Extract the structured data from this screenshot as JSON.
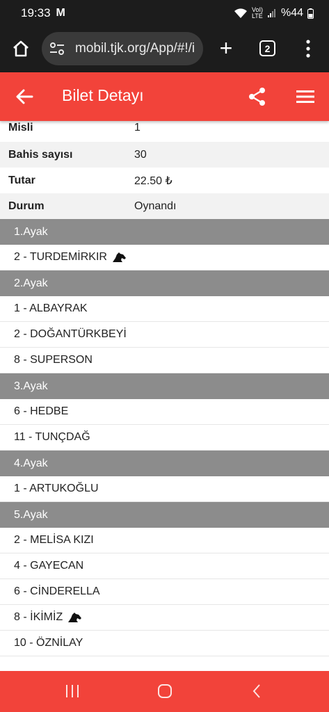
{
  "status_bar": {
    "time": "19:33",
    "m_badge": "M",
    "volte_top": "VoI)",
    "volte_bottom": "LTE",
    "battery": "%44"
  },
  "browser": {
    "url": "mobil.tjk.org/App/#!/i",
    "tab_count": "2"
  },
  "header": {
    "title": "Bilet Detayı"
  },
  "info": [
    {
      "key": "Misli",
      "value": "1"
    },
    {
      "key": "Bahis sayısı",
      "value": "30"
    },
    {
      "key": "Tutar",
      "value": "22.50 ₺"
    },
    {
      "key": "Durum",
      "value": "Oynandı"
    }
  ],
  "legs": [
    {
      "title": "1.Ayak",
      "horses": [
        {
          "label": "2 - TURDEMİRKIR",
          "icon": true
        }
      ]
    },
    {
      "title": "2.Ayak",
      "horses": [
        {
          "label": "1 - ALBAYRAK"
        },
        {
          "label": "2 - DOĞANTÜRKBEYİ"
        },
        {
          "label": "8 - SUPERSON"
        }
      ]
    },
    {
      "title": "3.Ayak",
      "horses": [
        {
          "label": "6 - HEDBE"
        },
        {
          "label": "11 - TUNÇDAĞ"
        }
      ]
    },
    {
      "title": "4.Ayak",
      "horses": [
        {
          "label": "1 - ARTUKOĞLU"
        }
      ]
    },
    {
      "title": "5.Ayak",
      "horses": [
        {
          "label": "2 - MELİSA KIZI"
        },
        {
          "label": "4 - GAYECAN"
        },
        {
          "label": "6 - CİNDERELLA"
        },
        {
          "label": "8 - İKİMİZ",
          "icon": true
        },
        {
          "label": "10 - ÖZNİLAY"
        }
      ]
    }
  ],
  "colors": {
    "accent": "#f2433a",
    "leg_header": "#8c8c8c",
    "browser_dark": "#1c1c1c"
  },
  "icons": {
    "home": "home-icon",
    "site_settings": "tune-icon",
    "new_tab": "plus-icon",
    "tabs": "tab-switcher-icon",
    "more": "more-vert-icon",
    "back": "arrow-back-icon",
    "share": "share-icon",
    "menu": "hamburger-icon",
    "horse": "horse-head-icon"
  }
}
